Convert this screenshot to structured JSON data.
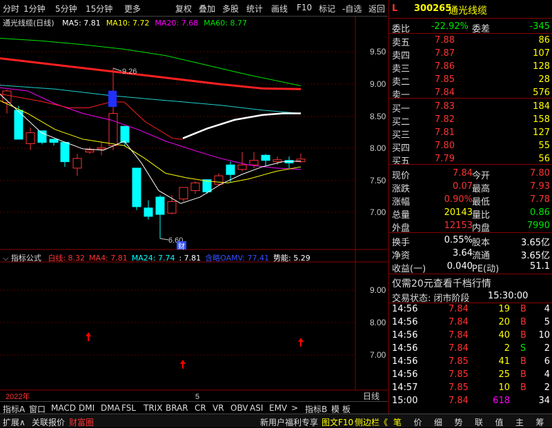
{
  "toolbar": {
    "periods": [
      "分时",
      "1分钟",
      "5分钟",
      "15分钟",
      "更多"
    ],
    "tools": [
      "复权",
      "叠加",
      "多股",
      "统计",
      "画线",
      "F10",
      "标记",
      "-自选",
      "返回"
    ]
  },
  "main_chart": {
    "title": "通光线缆(日线)",
    "ma_labels": [
      {
        "text": "MA5: 7.81",
        "color": "#ffffff"
      },
      {
        "text": "MA10: 7.72",
        "color": "#ffff00"
      },
      {
        "text": "MA20: 7.68",
        "color": "#ff00ff"
      },
      {
        "text": "MA60: 8.77",
        "color": "#00e600"
      }
    ],
    "y_ticks": [
      "9.50",
      "9.00",
      "8.50",
      "8.00",
      "7.50",
      "7.00"
    ],
    "high_label": "9.26",
    "low_label": "6.60",
    "event_label": "财"
  },
  "indicator": {
    "title": "指标公式",
    "labels": [
      {
        "text": "白线: 8.32",
        "color": "#ff3232"
      },
      {
        "text": "MA4: 7.81",
        "color": "#ff3232"
      },
      {
        "text": "MA24: 7.74",
        "color": "#00ffff"
      },
      {
        "text": ": 7.81",
        "color": "#ffffff"
      },
      {
        "text": "含略OAMV: 77.41",
        "color": "#3050ff"
      },
      {
        "text": "势能: 5.29",
        "color": "#ffffff"
      }
    ],
    "y_ticks": [
      "9.00",
      "8.00",
      "7.00"
    ]
  },
  "x_axis": {
    "year": "2022年",
    "month": "5",
    "period": "日线"
  },
  "bottom_tabs": [
    "指标A",
    "窗口",
    "MACD",
    "DMI",
    "DMA",
    "FSL",
    "TRIX",
    "BRAR",
    "CR",
    "VR",
    "OBV",
    "ASI",
    "EMV",
    ">",
    "指标B",
    "模",
    "板"
  ],
  "status_bar": {
    "left": [
      "扩展∧",
      "关联报价",
      "财富圈"
    ],
    "mid": [
      "新用户福利专享",
      "图文F10",
      "侧边栏《"
    ],
    "right": [
      "笔",
      "价",
      "细",
      "势",
      "联",
      "值",
      "主",
      "筹"
    ]
  },
  "quote": {
    "flag": "L",
    "code": "300265",
    "name": "通光线缆",
    "weibi_label": "委比",
    "weibi": "-22.92%",
    "weicha_label": "委差",
    "weicha": "-345",
    "asks": [
      {
        "label": "卖五",
        "price": "7.88",
        "vol": "86"
      },
      {
        "label": "卖四",
        "price": "7.87",
        "vol": "107"
      },
      {
        "label": "卖三",
        "price": "7.86",
        "vol": "128"
      },
      {
        "label": "卖二",
        "price": "7.85",
        "vol": "28"
      },
      {
        "label": "卖一",
        "price": "7.84",
        "vol": "576"
      }
    ],
    "bids": [
      {
        "label": "买一",
        "price": "7.83",
        "vol": "184"
      },
      {
        "label": "买二",
        "price": "7.82",
        "vol": "158"
      },
      {
        "label": "买三",
        "price": "7.81",
        "vol": "127"
      },
      {
        "label": "买四",
        "price": "7.80",
        "vol": "55"
      },
      {
        "label": "买五",
        "price": "7.79",
        "vol": "56"
      }
    ],
    "stats": [
      {
        "l1": "现价",
        "v1": "7.84",
        "c1": "red",
        "l2": "今开",
        "v2": "7.80",
        "c2": "red"
      },
      {
        "l1": "涨跌",
        "v1": "0.07",
        "c1": "red",
        "l2": "最高",
        "v2": "7.93",
        "c2": "red"
      },
      {
        "l1": "涨幅",
        "v1": "0.90%",
        "c1": "red",
        "l2": "最低",
        "v2": "7.78",
        "c2": "red"
      },
      {
        "l1": "总量",
        "v1": "20143",
        "c1": "yellow",
        "l2": "量比",
        "v2": "0.86",
        "c2": "green"
      },
      {
        "l1": "外盘",
        "v1": "12153",
        "c1": "red",
        "l2": "内盘",
        "v2": "7990",
        "c2": "green"
      }
    ],
    "stats2": [
      {
        "l1": "换手",
        "v1": "0.55%",
        "l2": "股本",
        "v2": "3.65亿"
      },
      {
        "l1": "净资",
        "v1": "3.64",
        "l2": "流通",
        "v2": "3.65亿"
      },
      {
        "l1": "收益(一)",
        "v1": "0.040",
        "l2": "PE(动)",
        "v2": "51.1"
      }
    ],
    "promo": "仅需20元查看千档行情",
    "trade_status": "交易状态: 闭市阶段",
    "trade_time": "15:30:00",
    "ticks": [
      {
        "time": "14:56",
        "price": "7.84",
        "vol": "19",
        "side": "B",
        "cnt": "4"
      },
      {
        "time": "14:56",
        "price": "7.84",
        "vol": "20",
        "side": "B",
        "cnt": "5"
      },
      {
        "time": "14:56",
        "price": "7.84",
        "vol": "40",
        "side": "B",
        "cnt": "10"
      },
      {
        "time": "14:56",
        "price": "7.84",
        "vol": "2",
        "side": "S",
        "cnt": "2"
      },
      {
        "time": "14:56",
        "price": "7.85",
        "vol": "41",
        "side": "B",
        "cnt": "6"
      },
      {
        "time": "14:56",
        "price": "7.85",
        "vol": "25",
        "side": "B",
        "cnt": "4"
      },
      {
        "time": "14:57",
        "price": "7.85",
        "vol": "10",
        "side": "B",
        "cnt": "2"
      },
      {
        "time": "15:00",
        "price": "7.84",
        "vol": "618",
        "side": "",
        "cnt": "34"
      }
    ]
  },
  "colors": {
    "up": "#ff3232",
    "down": "#00ffff",
    "ma5": "#ffffff",
    "ma10": "#ffff00",
    "ma20": "#ff00ff",
    "ma60": "#00e600",
    "frame": "#8b0000"
  }
}
